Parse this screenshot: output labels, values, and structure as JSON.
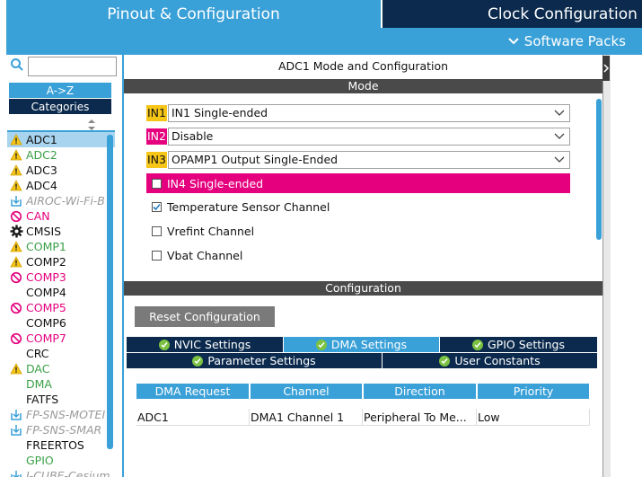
{
  "tabs": {
    "pinout": "Pinout & Configuration",
    "clock": "Clock Configuration"
  },
  "software_packs": "Software Packs",
  "sidebar": {
    "search_value": "",
    "az_label": "A->Z",
    "categories_label": "Categories",
    "items": [
      {
        "label": "ADC1",
        "icon": "warning-icon",
        "color": "#111111",
        "italic": false
      },
      {
        "label": "ADC2",
        "icon": "warning-icon",
        "color": "#3aa046",
        "italic": false
      },
      {
        "label": "ADC3",
        "icon": "warning-icon",
        "color": "#111111",
        "italic": false
      },
      {
        "label": "ADC4",
        "icon": "warning-icon",
        "color": "#111111",
        "italic": false
      },
      {
        "label": "AIROC-Wi-Fi-B",
        "icon": "download-icon",
        "color": "#9a9a9a",
        "italic": true
      },
      {
        "label": "CAN",
        "icon": "disabled-icon",
        "color": "#e5007e",
        "italic": false
      },
      {
        "label": "CMSIS",
        "icon": "gear-icon",
        "color": "#111111",
        "italic": false
      },
      {
        "label": "COMP1",
        "icon": "warning-icon",
        "color": "#3aa046",
        "italic": false
      },
      {
        "label": "COMP2",
        "icon": "warning-icon",
        "color": "#111111",
        "italic": false
      },
      {
        "label": "COMP3",
        "icon": "disabled-icon",
        "color": "#e5007e",
        "italic": false
      },
      {
        "label": "COMP4",
        "icon": "",
        "color": "#111111",
        "italic": false
      },
      {
        "label": "COMP5",
        "icon": "disabled-icon",
        "color": "#e5007e",
        "italic": false
      },
      {
        "label": "COMP6",
        "icon": "",
        "color": "#111111",
        "italic": false
      },
      {
        "label": "COMP7",
        "icon": "disabled-icon",
        "color": "#e5007e",
        "italic": false
      },
      {
        "label": "CRC",
        "icon": "",
        "color": "#111111",
        "italic": false
      },
      {
        "label": "DAC",
        "icon": "warning-icon",
        "color": "#3aa046",
        "italic": false
      },
      {
        "label": "DMA",
        "icon": "",
        "color": "#3aa046",
        "italic": false
      },
      {
        "label": "FATFS",
        "icon": "",
        "color": "#111111",
        "italic": false
      },
      {
        "label": "FP-SNS-MOTEI",
        "icon": "download-icon",
        "color": "#9a9a9a",
        "italic": true
      },
      {
        "label": "FP-SNS-SMAR",
        "icon": "download-icon",
        "color": "#9a9a9a",
        "italic": true
      },
      {
        "label": "FREERTOS",
        "icon": "",
        "color": "#111111",
        "italic": false
      },
      {
        "label": "GPIO",
        "icon": "",
        "color": "#3aa046",
        "italic": false
      },
      {
        "label": "I-CUBE-Cesium",
        "icon": "download-icon",
        "color": "#9a9a9a",
        "italic": true
      }
    ]
  },
  "mode": {
    "title": "ADC1 Mode and Configuration",
    "header": "Mode",
    "inputs": [
      {
        "tag": "IN1",
        "value": "IN1 Single-ended"
      },
      {
        "tag": "IN2",
        "value": "Disable"
      },
      {
        "tag": "IN3",
        "value": "OPAMP1 Output Single-Ended"
      }
    ],
    "in4_label": "IN4 Single-ended",
    "checkboxes": [
      {
        "label": "Temperature Sensor Channel",
        "checked": true
      },
      {
        "label": "Vrefint Channel",
        "checked": false
      },
      {
        "label": "Vbat Channel",
        "checked": false
      }
    ]
  },
  "config": {
    "header": "Configuration",
    "reset_label": "Reset Configuration",
    "tabs": {
      "nvic": "NVIC Settings",
      "dma": "DMA Settings",
      "gpio": "GPIO Settings",
      "parameter": "Parameter Settings",
      "user": "User Constants"
    },
    "table": {
      "headers": [
        "DMA Request",
        "Channel",
        "Direction",
        "Priority"
      ],
      "rows": [
        [
          "ADC1",
          "DMA1 Channel 1",
          "Peripheral To Me...",
          "Low"
        ]
      ]
    }
  }
}
